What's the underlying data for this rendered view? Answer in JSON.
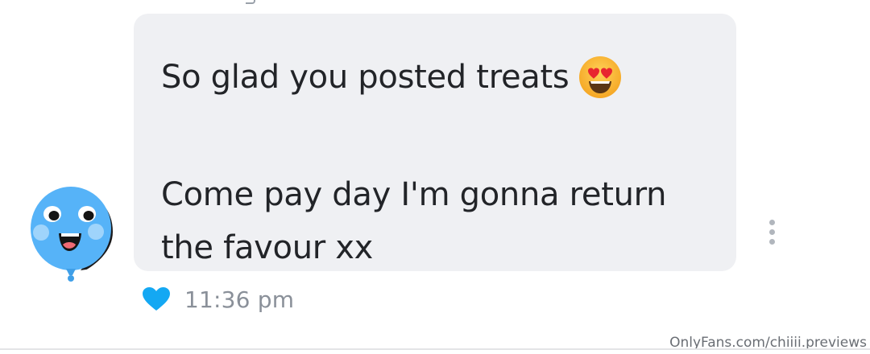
{
  "message": {
    "line1": "So glad you posted treats",
    "line1_emoji": "smiling-face-with-heart-eyes-emoji",
    "line2": "Come pay day I'm gonna return",
    "line3": "the favour xx"
  },
  "meta": {
    "timestamp": "11:36 pm",
    "liked": true,
    "like_icon": "heart-icon",
    "heart_color": "#14a8f3"
  },
  "sender": {
    "avatar_icon": "balloon-face-avatar",
    "avatar_color": "#56b3f8"
  },
  "actions": {
    "more_icon": "vertical-dots-icon"
  },
  "watermark": "OnlyFans.com/chiiii.previews",
  "colors": {
    "bubble_background": "#eff0f3",
    "text": "#222428",
    "timestamp_text": "#8a9099"
  }
}
